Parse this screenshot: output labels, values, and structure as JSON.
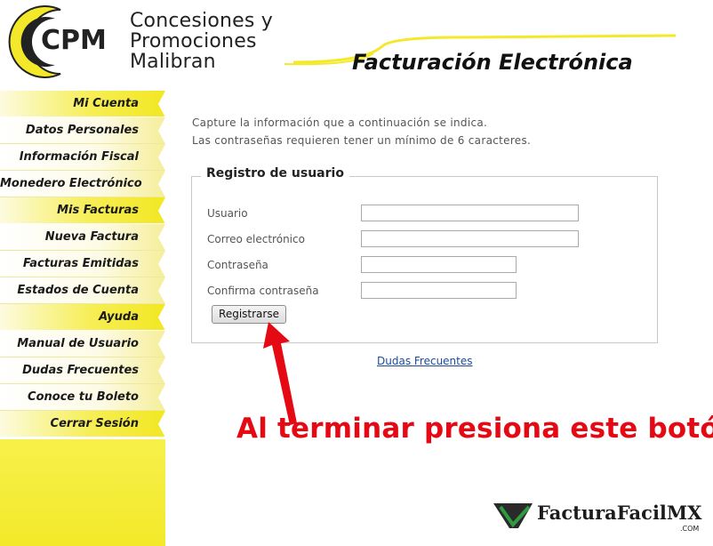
{
  "header": {
    "logo_text": "CPM",
    "brand_line1": "Concesiones y",
    "brand_line2": "Promociones",
    "brand_line3": "Malibran",
    "page_title": "Facturación Electrónica"
  },
  "sidebar": {
    "items": [
      {
        "label": "Mi Cuenta",
        "kind": "section"
      },
      {
        "label": "Datos Personales",
        "kind": "link"
      },
      {
        "label": "Información Fiscal",
        "kind": "link"
      },
      {
        "label": "Monedero Electrónico",
        "kind": "link"
      },
      {
        "label": "Mis Facturas",
        "kind": "section"
      },
      {
        "label": "Nueva Factura",
        "kind": "link"
      },
      {
        "label": "Facturas Emitidas",
        "kind": "link"
      },
      {
        "label": "Estados de Cuenta",
        "kind": "link"
      },
      {
        "label": "Ayuda",
        "kind": "section"
      },
      {
        "label": "Manual de Usuario",
        "kind": "link"
      },
      {
        "label": "Dudas Frecuentes",
        "kind": "link"
      },
      {
        "label": "Conoce tu Boleto",
        "kind": "link"
      },
      {
        "label": "Cerrar Sesión",
        "kind": "section"
      }
    ]
  },
  "main": {
    "intro_line1": "Capture la información que a continuación se indica.",
    "intro_line2": "Las contraseñas requieren tener un mínimo de 6 caracteres.",
    "form": {
      "legend": "Registro de usuario",
      "fields": [
        {
          "label": "Usuario",
          "value": ""
        },
        {
          "label": "Correo electrónico",
          "value": ""
        },
        {
          "label": "Contraseña",
          "value": ""
        },
        {
          "label": "Confirma contraseña",
          "value": ""
        }
      ],
      "submit_label": "Registrarse"
    },
    "faq_link": "Dudas Frecuentes"
  },
  "annotation": {
    "text": "Al terminar presiona este botón",
    "color": "#e50914"
  },
  "watermark": {
    "name": "FacturaFacilMX",
    "suffix": ".COM"
  },
  "colors": {
    "brand_yellow": "#f3e92a",
    "link_blue": "#1a4a9c"
  }
}
